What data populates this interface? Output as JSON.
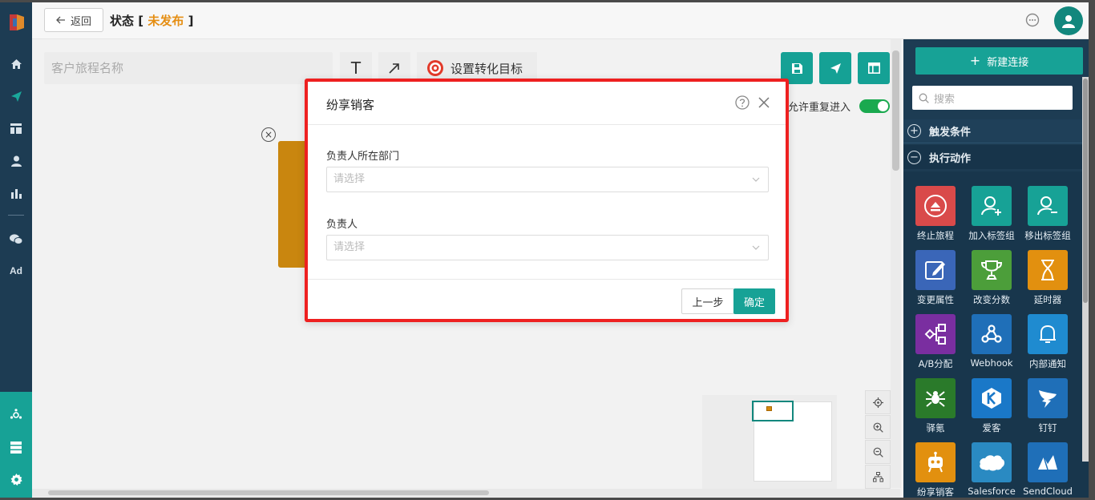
{
  "header": {
    "back_label": "返回",
    "status_label": "状态",
    "status_open": "[",
    "status_value": "未发布",
    "status_close": "]",
    "status_color": "#e58e13"
  },
  "toolbar": {
    "name_placeholder": "客户旅程名称",
    "text_tool_glyph": "T",
    "goal_label": "设置转化目标",
    "allow_reentry_label": "允许重复进入",
    "allow_reentry_enabled": true
  },
  "right_panel": {
    "new_connection_label": "新建连接",
    "search_placeholder": "搜索",
    "sections": [
      {
        "label": "触发条件",
        "state": "collapsed"
      },
      {
        "label": "执行动作",
        "state": "expanded"
      }
    ],
    "tiles": [
      {
        "label": "终止旅程",
        "icon": "eject-icon",
        "color": "#d94a4a"
      },
      {
        "label": "加入标签组",
        "icon": "user-plus-icon",
        "color": "#17a296"
      },
      {
        "label": "移出标签组",
        "icon": "user-minus-icon",
        "color": "#17a296"
      },
      {
        "label": "变更属性",
        "icon": "edit-icon",
        "color": "#3a66b8"
      },
      {
        "label": "改变分数",
        "icon": "trophy-icon",
        "color": "#4c9e3a"
      },
      {
        "label": "延时器",
        "icon": "hourglass-icon",
        "color": "#e2900f"
      },
      {
        "label": "A/B分配",
        "icon": "ab-split-icon",
        "color": "#7a2ea0"
      },
      {
        "label": "Webhook",
        "icon": "webhook-icon",
        "color": "#1f6fb8"
      },
      {
        "label": "内部通知",
        "icon": "bell-icon",
        "color": "#1f8bd0"
      },
      {
        "label": "驿氪",
        "icon": "spider-icon",
        "color": "#2a7a2a"
      },
      {
        "label": "爱客",
        "icon": "k-logo-icon",
        "color": "#1a78c8"
      },
      {
        "label": "钉钉",
        "icon": "dingtalk-icon",
        "color": "#1f6fb8"
      },
      {
        "label": "纷享销客",
        "icon": "robot-icon",
        "color": "#e2900f"
      },
      {
        "label": "Salesforce",
        "icon": "cloud-icon",
        "color": "#2a8ac2"
      },
      {
        "label": "SendCloud",
        "icon": "sendcloud-icon",
        "color": "#1f6fb8"
      }
    ]
  },
  "modal": {
    "title": "纷享销客",
    "field1_label": "负责人所在部门",
    "field1_placeholder": "请选择",
    "field2_label": "负责人",
    "field2_placeholder": "请选择",
    "prev_label": "上一步",
    "ok_label": "确定"
  },
  "colors": {
    "accent": "#17a296",
    "nav_bg": "#1d3c53",
    "highlight_border": "#ee2020"
  }
}
